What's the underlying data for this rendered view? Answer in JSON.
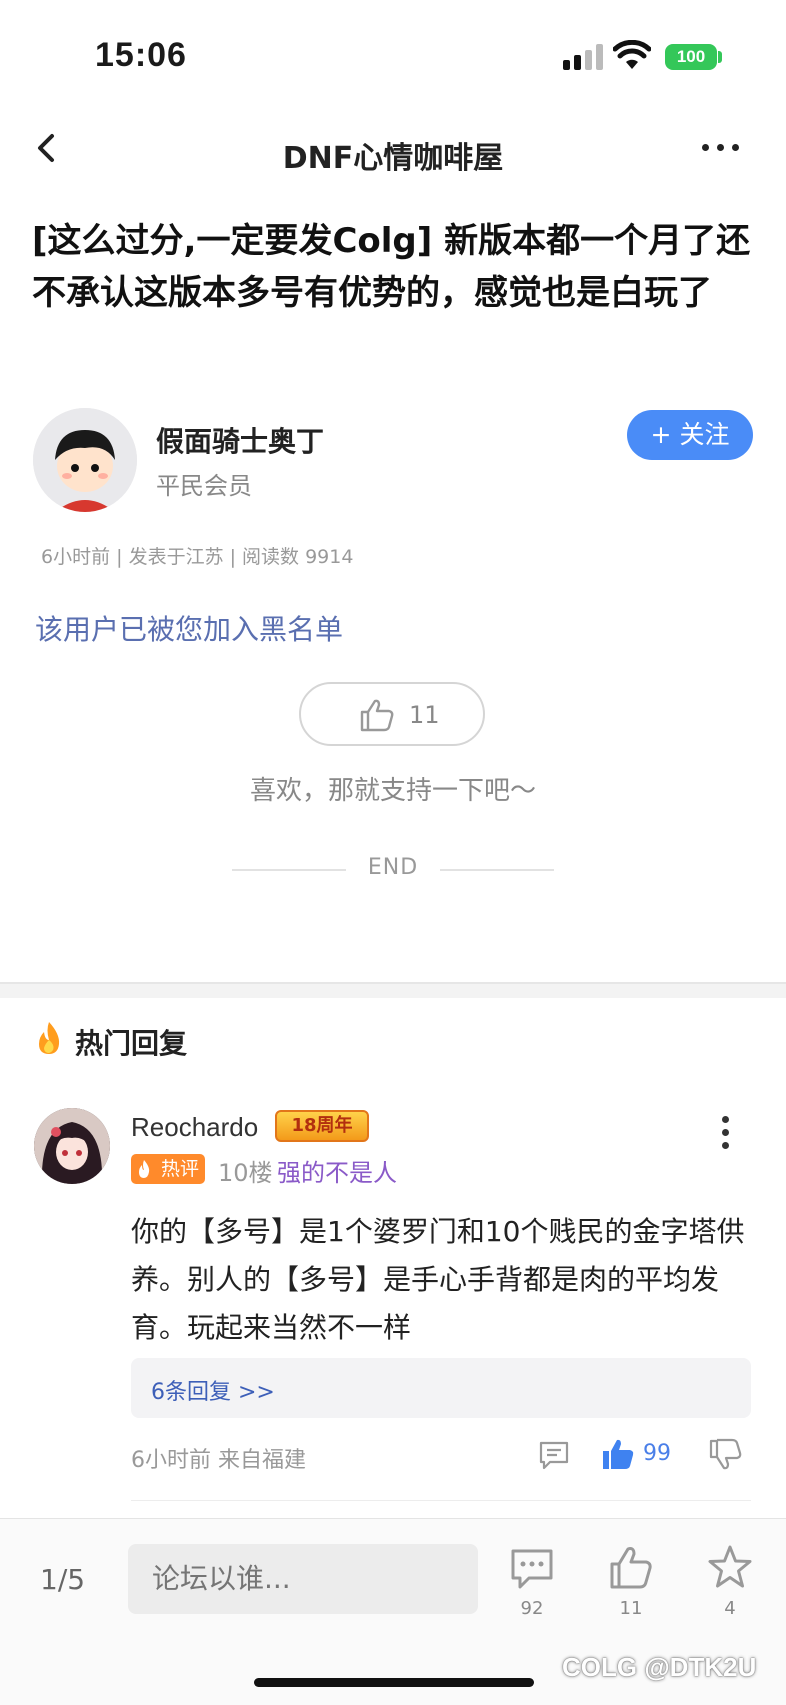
{
  "status_bar": {
    "time": "15:06",
    "battery": "100"
  },
  "nav": {
    "title": "DNF心情咖啡屋"
  },
  "post": {
    "title": "[这么过分,一定要发Colg] 新版本都一个月了还不承认这版本多号有优势的，感觉也是白玩了",
    "author": "假面骑士奥丁",
    "author_rank": "平民会员",
    "follow_label": "+ 关注",
    "meta": "6小时前 | 发表于江苏 | 阅读数 9914",
    "blacklist_notice": "该用户已被您加入黑名单",
    "like_count": "11",
    "support_text": "喜欢，那就支持一下吧～",
    "end_label": "END"
  },
  "hot_replies": {
    "section_title": "热门回复",
    "items": [
      {
        "username": "Reochardo",
        "badge": "18周年",
        "hot_tag": "热评",
        "floor": "10楼",
        "user_title": "强的不是人",
        "body": "你的【多号】是1个婆罗门和10个贱民的金字塔供养。别人的【多号】是手心手背都是肉的平均发育。玩起来当然不一样",
        "sub_replies": "6条回复 >>",
        "time_location": "6小时前 来自福建",
        "likes": "99"
      }
    ]
  },
  "bottom_bar": {
    "page": "1/5",
    "input_placeholder": "论坛以谁...",
    "comment_count": "92",
    "like_count": "11",
    "favorite_count": "4"
  },
  "watermark": "COLG @DTK2U",
  "colors": {
    "accent": "#4a8cf7",
    "link": "#5a6fb0",
    "hot": "#ff8a2b",
    "title_purple": "#8a5ac8"
  }
}
